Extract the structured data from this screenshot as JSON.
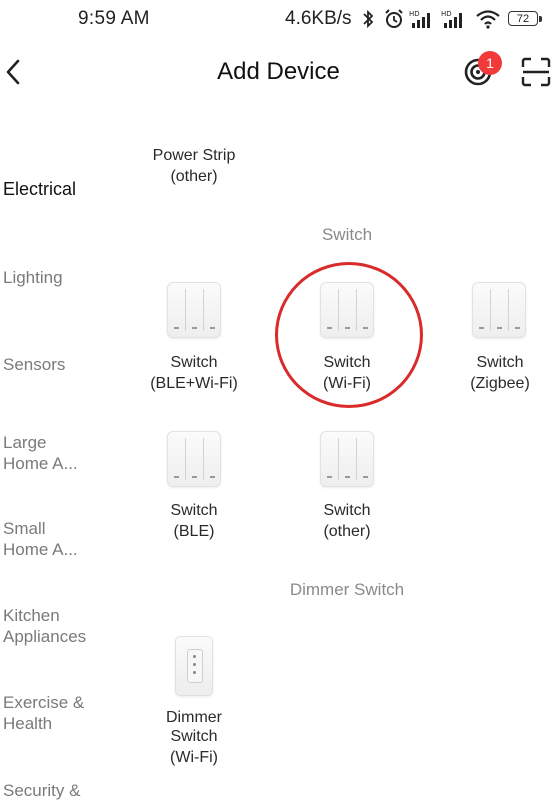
{
  "status_bar": {
    "time": "9:59 AM",
    "network_speed": "4.6KB/s",
    "battery": "72",
    "icons": [
      "bluetooth-icon",
      "alarm-icon",
      "hd-signal-icon",
      "hd-signal-icon",
      "wifi-icon",
      "battery-icon"
    ]
  },
  "header": {
    "title": "Add Device",
    "notification_count": "1",
    "icons": [
      "back-icon",
      "target-icon",
      "scan-icon"
    ]
  },
  "sidebar": {
    "items": [
      {
        "label": "Electrical",
        "active": true
      },
      {
        "label": "Lighting"
      },
      {
        "label": "Sensors"
      },
      {
        "label": "Large\nHome A..."
      },
      {
        "label": "Small\nHome A..."
      },
      {
        "label": "Kitchen\nAppliances"
      },
      {
        "label": "Exercise &\nHealth"
      },
      {
        "label": "Security &"
      }
    ]
  },
  "content": {
    "top_item": {
      "line1": "Power Strip",
      "line2": "(other)"
    },
    "sections": [
      {
        "title": "Switch",
        "devices": [
          {
            "line1": "Switch",
            "line2": "(BLE+Wi-Fi)"
          },
          {
            "line1": "Switch",
            "line2": "(Wi-Fi)",
            "highlighted": true
          },
          {
            "line1": "Switch",
            "line2": "(Zigbee)"
          },
          {
            "line1": "Switch",
            "line2": "(BLE)"
          },
          {
            "line1": "Switch",
            "line2": "(other)"
          }
        ]
      },
      {
        "title": "Dimmer Switch",
        "devices": [
          {
            "line1": "Dimmer",
            "line2": "Switch",
            "line3": "(Wi-Fi)"
          }
        ]
      }
    ]
  },
  "colors": {
    "highlight": "#d92b2b",
    "badge": "#f23a3a"
  }
}
